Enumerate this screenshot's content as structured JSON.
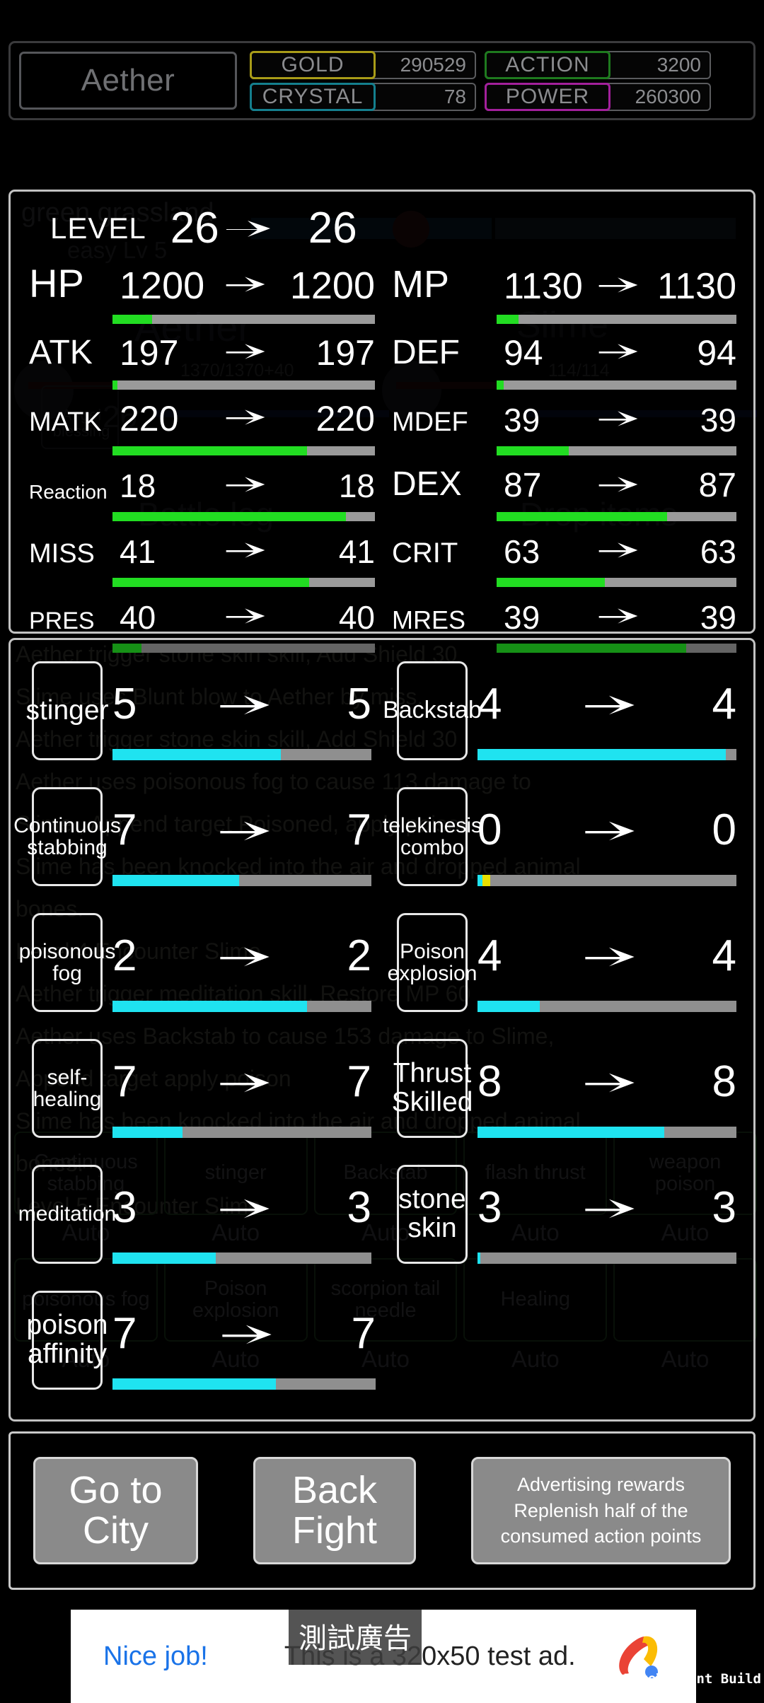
{
  "header": {
    "player_name": "Aether",
    "resources": [
      {
        "label": "GOLD",
        "value": "290529",
        "color": "#a99c18"
      },
      {
        "label": "ACTION",
        "value": "3200",
        "color": "#1e7a1e"
      },
      {
        "label": "CRYSTAL",
        "value": "78",
        "color": "#147f8e"
      },
      {
        "label": "POWER",
        "value": "260300",
        "color": "#a3209c"
      }
    ]
  },
  "background": {
    "stage_name": "green grassland",
    "stage_difficulty": "easy Lv 5",
    "player_label": "Aether",
    "enemy_label": "Slime",
    "player_hp_text": "1370/1370+40",
    "enemy_hp_text": "114/114",
    "player_level": "26",
    "battle_log_title": "Battle log",
    "drop_items_title": "Drop items",
    "blessing_label": "Angel blessing",
    "log_lines": [
      "Aether  trigger stone skin skill, Add Shield 30",
      "Slime  uses Blunt blow to Aether  by miss.",
      "Aether  trigger stone skin skill, Add Shield 30",
      "Aether  uses poisonous fog to cause 113 damage to",
      "Slime , Append target Poisoned, apply poison",
      "Slime  has been knocked into the air and dropped animal",
      "bones.",
      "Level 4 Encounter Slime",
      "Aether  trigger meditation skill, Restore MP 60",
      "Aether  uses Backstab to cause 153 damage to Slime,",
      "Append target apply poison",
      "Slime  has been knocked into the air and dropped animal",
      "bones.",
      "Level 5 Encounter Slime"
    ],
    "skill_grid": [
      [
        "Continuous stabbing",
        "stinger",
        "Backstab",
        "flash thrust",
        "weapon poison"
      ],
      [
        "poisonous fog",
        "Poison explosion",
        "scorpion tail needle",
        "Healing",
        ""
      ]
    ],
    "auto_label": "Auto"
  },
  "stats": {
    "level": {
      "label": "LEVEL",
      "from": "26",
      "to": "26"
    },
    "left": [
      {
        "key": "hp",
        "label": "HP",
        "from": "1200",
        "to": "1200",
        "fill": 15
      },
      {
        "key": "atk",
        "label": "ATK",
        "from": "197",
        "to": "197",
        "fill": 2
      },
      {
        "key": "matk",
        "label": "MATK",
        "from": "220",
        "to": "220",
        "fill": 74
      },
      {
        "key": "rea",
        "label": "Reaction",
        "from": "18",
        "to": "18",
        "fill": 89
      },
      {
        "key": "miss",
        "label": "MISS",
        "from": "41",
        "to": "41",
        "fill": 75
      },
      {
        "key": "pres",
        "label": "PRES",
        "from": "40",
        "to": "40",
        "fill": 11
      }
    ],
    "right": [
      {
        "key": "mp",
        "label": "MP",
        "from": "1130",
        "to": "1130",
        "fill": 9
      },
      {
        "key": "def",
        "label": "DEF",
        "from": "94",
        "to": "94",
        "fill": 3
      },
      {
        "key": "mdef",
        "label": "MDEF",
        "from": "39",
        "to": "39",
        "fill": 30
      },
      {
        "key": "dex",
        "label": "DEX",
        "from": "87",
        "to": "87",
        "fill": 71
      },
      {
        "key": "crit",
        "label": "CRIT",
        "from": "63",
        "to": "63",
        "fill": 45
      },
      {
        "key": "mres",
        "label": "MRES",
        "from": "39",
        "to": "39",
        "fill": 79
      }
    ]
  },
  "skills": [
    [
      {
        "name": "stinger",
        "size": "s3",
        "from": "5",
        "to": "5",
        "fill": 65,
        "mark": 0
      },
      {
        "name": "Backstab",
        "size": "s1",
        "from": "4",
        "to": "4",
        "fill": 96,
        "mark": 0
      }
    ],
    [
      {
        "name": "Continuous stabbing",
        "size": "s2",
        "from": "7",
        "to": "7",
        "fill": 49,
        "mark": 0
      },
      {
        "name": "telekinesis combo",
        "size": "s2",
        "from": "0",
        "to": "0",
        "fill": 2,
        "mark": 3
      }
    ],
    [
      {
        "name": "poisonous fog",
        "size": "s2",
        "from": "2",
        "to": "2",
        "fill": 75,
        "mark": 0
      },
      {
        "name": "Poison explosion",
        "size": "s2",
        "from": "4",
        "to": "4",
        "fill": 24,
        "mark": 0
      }
    ],
    [
      {
        "name": "self-healing",
        "size": "s2",
        "from": "7",
        "to": "7",
        "fill": 27,
        "mark": 0
      },
      {
        "name": "Thrust Skilled",
        "size": "s3",
        "from": "8",
        "to": "8",
        "fill": 72,
        "mark": 0
      }
    ],
    [
      {
        "name": "meditation",
        "size": "s2",
        "from": "3",
        "to": "3",
        "fill": 40,
        "mark": 0
      },
      {
        "name": "stone skin",
        "size": "s3",
        "from": "3",
        "to": "3",
        "fill": 1,
        "mark": 0
      }
    ],
    [
      {
        "name": "poison affinity",
        "size": "s3",
        "from": "7",
        "to": "7",
        "fill": 62,
        "mark": 0
      }
    ]
  ],
  "buttons": {
    "go_to_city": "Go to City",
    "back_fight": "Back Fight",
    "ad_reward": "Advertising rewards Replenish half of the consumed action points"
  },
  "ad": {
    "cta": "Nice job!",
    "body": "This is a 320x50 test ad.",
    "chip": "測試廣告",
    "watermark": "Development Build"
  }
}
